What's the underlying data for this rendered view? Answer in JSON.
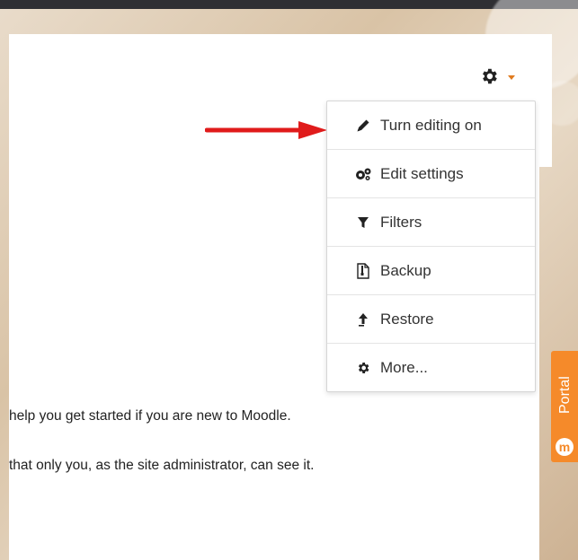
{
  "menu": {
    "items": [
      {
        "label": "Turn editing on",
        "icon": "pencil-icon"
      },
      {
        "label": "Edit settings",
        "icon": "gears-icon"
      },
      {
        "label": "Filters",
        "icon": "filter-icon"
      },
      {
        "label": "Backup",
        "icon": "backup-file-icon"
      },
      {
        "label": "Restore",
        "icon": "upload-arrow-icon"
      },
      {
        "label": "More...",
        "icon": "gear-icon"
      }
    ]
  },
  "content": {
    "line1": "help you get started if you are new to Moodle.",
    "line2": "that only you, as the site administrator, can see it."
  },
  "portal": {
    "label": "Portal",
    "logo_letter": "m"
  },
  "colors": {
    "accent": "#e07b1f",
    "annotation_arrow": "#e01b1b",
    "portal_tab": "#f58a2a"
  }
}
